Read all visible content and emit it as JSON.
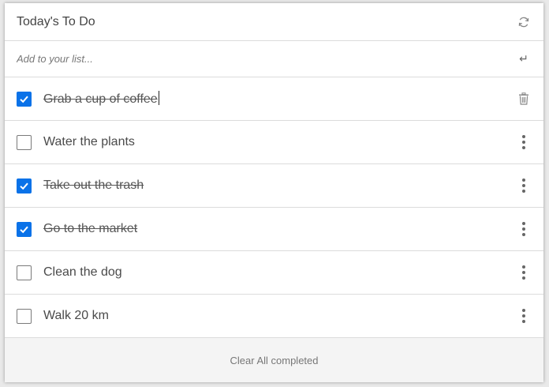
{
  "header": {
    "title": "Today's To Do",
    "refresh_icon": "refresh-icon"
  },
  "add": {
    "placeholder": "Add to your list...",
    "value": "",
    "enter_icon": "enter-icon"
  },
  "items": [
    {
      "label": "Grab a cup of coffee",
      "checked": true,
      "action_icon": "trash-icon",
      "editing": true
    },
    {
      "label": "Water the plants",
      "checked": false,
      "action_icon": "more-vertical-icon"
    },
    {
      "label": "Take out the trash",
      "checked": true,
      "action_icon": "more-vertical-icon"
    },
    {
      "label": "Go to the market",
      "checked": true,
      "action_icon": "more-vertical-icon"
    },
    {
      "label": "Clean the dog",
      "checked": false,
      "action_icon": "more-vertical-icon"
    },
    {
      "label": "Walk 20 km",
      "checked": false,
      "action_icon": "more-vertical-icon"
    }
  ],
  "footer": {
    "clear_label": "Clear All completed"
  },
  "colors": {
    "accent": "#0a72e8",
    "border": "#dcdcdc",
    "footer_bg": "#f4f4f4"
  }
}
